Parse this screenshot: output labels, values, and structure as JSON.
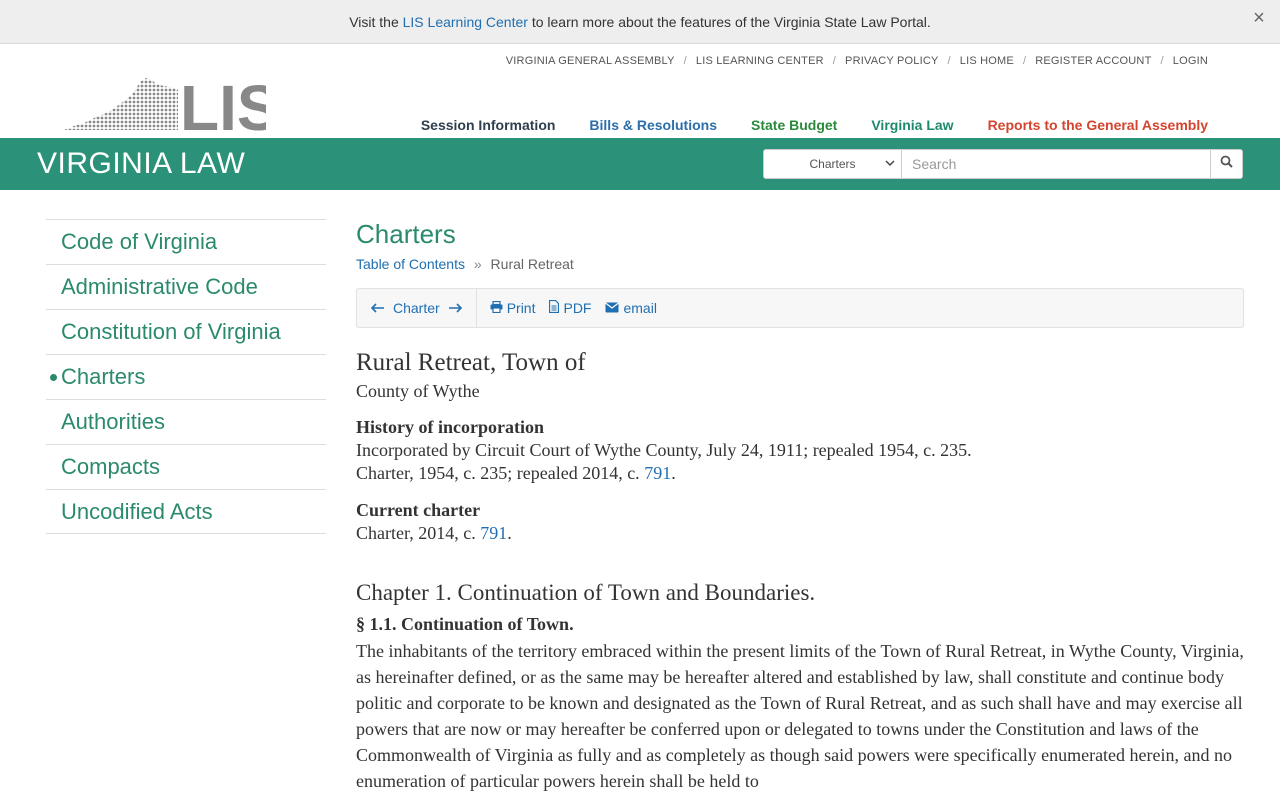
{
  "banner": {
    "prefix": "Visit the",
    "link": "LIS Learning Center",
    "suffix": "to learn more about the features of the Virginia State Law Portal.",
    "close_glyph": "×"
  },
  "utility_nav": [
    "VIRGINIA GENERAL ASSEMBLY",
    "LIS LEARNING CENTER",
    "PRIVACY POLICY",
    "LIS HOME",
    "REGISTER ACCOUNT",
    "LOGIN"
  ],
  "utility_separator": "/",
  "main_nav": [
    {
      "label": "Session Information",
      "color": "#2e3e4e"
    },
    {
      "label": "Bills & Resolutions",
      "color": "#2c6eaa"
    },
    {
      "label": "State Budget",
      "color": "#2a8a3a"
    },
    {
      "label": "Virginia Law",
      "color": "#1e8a6d"
    },
    {
      "label": "Reports to the General Assembly",
      "color": "#d4442e"
    }
  ],
  "logo": {
    "text": "LIS",
    "color": "#888888"
  },
  "section_title": "VIRGINIA LAW",
  "search": {
    "scope": "Charters",
    "placeholder": "Search",
    "icon": "search-icon"
  },
  "sidebar": {
    "items": [
      {
        "label": "Code of Virginia",
        "active": false
      },
      {
        "label": "Administrative Code",
        "active": false
      },
      {
        "label": "Constitution of Virginia",
        "active": false
      },
      {
        "label": "Charters",
        "active": true
      },
      {
        "label": "Authorities",
        "active": false
      },
      {
        "label": "Compacts",
        "active": false
      },
      {
        "label": "Uncodified Acts",
        "active": false
      }
    ]
  },
  "page": {
    "title": "Charters",
    "breadcrumb": {
      "link": "Table of Contents",
      "sep": "»",
      "current": "Rural Retreat"
    }
  },
  "toolbar": {
    "nav_label": "Charter",
    "print": "Print",
    "pdf": "PDF",
    "email": "email"
  },
  "doc": {
    "heading": "Rural Retreat, Town of",
    "county": "County of Wythe",
    "history_heading": "History of incorporation",
    "history_line1": "Incorporated by Circuit Court of Wythe County, July 24, 1911; repealed 1954, c. 235.",
    "history_line2_prefix": "Charter, 1954, c. 235; repealed 2014, c.",
    "history_line2_link": "791",
    "period": ".",
    "current_heading": "Current charter",
    "current_prefix": "Charter, 2014, c.",
    "current_link": "791",
    "chapter": "Chapter 1. Continuation of Town and Boundaries.",
    "section": "§ 1.1. Continuation of Town.",
    "paragraph": "The inhabitants of the territory embraced within the present limits of the Town of Rural Retreat, in Wythe County, Virginia, as hereinafter defined, or as the same may be hereafter altered and established by law, shall constitute and continue body politic and corporate to be known and designated as the Town of Rural Retreat, and as such shall have and may exercise all powers that are now or may hereafter be conferred upon or delegated to towns under the Constitution and laws of the Commonwealth of Virginia as fully and as completely as though said powers were specifically enumerated herein, and no enumeration of particular powers herein shall be held to"
  },
  "colors": {
    "accent_green": "#2b9279",
    "link_blue": "#1f6fb2",
    "sidebar_green": "#2b8a6d"
  }
}
